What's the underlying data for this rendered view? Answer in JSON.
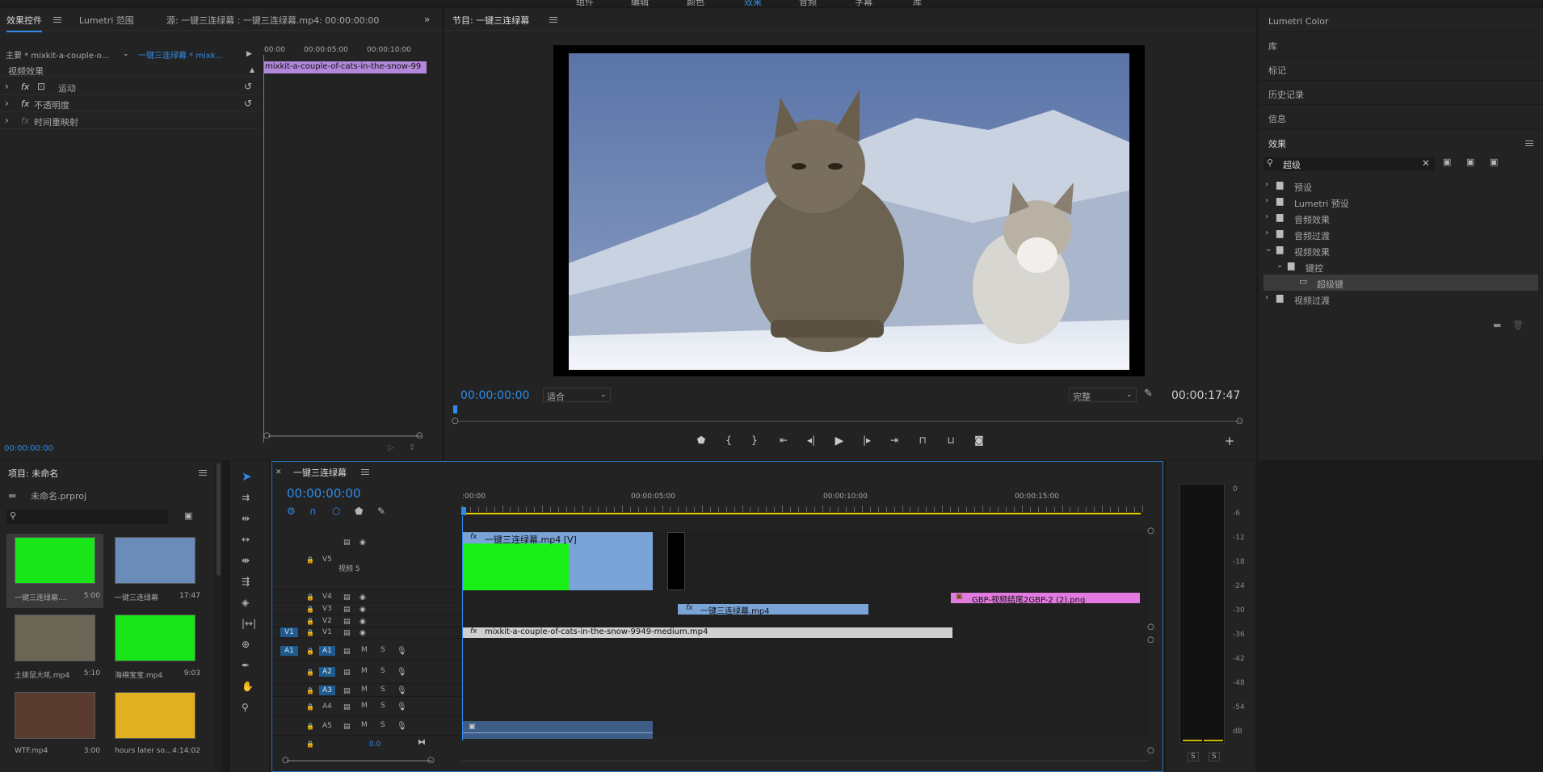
{
  "topbar": {
    "items": [
      "组件",
      "编辑",
      "颜色",
      "效果",
      "音频",
      "字幕",
      "库"
    ],
    "active": "效果"
  },
  "effect_controls": {
    "tabs": [
      "效果控件",
      "Lumetri 范围",
      "源: 一键三连绿幕 : 一键三连绿幕.mp4: 00:00:00:00"
    ],
    "master_label": "主要 * mixkit-a-couple-o...",
    "sequence_label": "一键三连绿幕 * mixk...",
    "ruler": [
      "00:00",
      "00:00:05:00",
      "00:00:10:00"
    ],
    "clip_name": "mixkit-a-couple-of-cats-in-the-snow-99",
    "section": "视频效果",
    "effects": [
      {
        "fx": "fx",
        "label": "运动"
      },
      {
        "fx": "fx",
        "label": "不透明度"
      },
      {
        "fx": "fx",
        "label": "时间重映射"
      }
    ],
    "timecode": "00:00:00:00"
  },
  "program": {
    "title": "节目: 一键三连绿幕",
    "timecode_left": "00:00:00:00",
    "fit": "适合",
    "quality": "完整",
    "timecode_right": "00:00:17:47"
  },
  "right_panels": {
    "items": [
      "Lumetri Color",
      "库",
      "标记",
      "历史记录",
      "信息"
    ],
    "effects_title": "效果",
    "search_value": "超级",
    "tree": [
      {
        "label": "预设",
        "level": 0,
        "exp": "›"
      },
      {
        "label": "Lumetri 预设",
        "level": 0,
        "exp": "›"
      },
      {
        "label": "音频效果",
        "level": 0,
        "exp": "›"
      },
      {
        "label": "音频过渡",
        "level": 0,
        "exp": "›"
      },
      {
        "label": "视频效果",
        "level": 0,
        "exp": "⌄"
      },
      {
        "label": "键控",
        "level": 1,
        "exp": "⌄"
      },
      {
        "label": "超级键",
        "level": 2,
        "exp": ""
      },
      {
        "label": "视频过渡",
        "level": 0,
        "exp": "›"
      }
    ]
  },
  "project": {
    "title": "项目: 未命名",
    "file": "未命名.prproj",
    "items": [
      {
        "name": "一键三连绿幕....",
        "dur": "5:00",
        "color": "#19e619"
      },
      {
        "name": "一键三连绿幕",
        "dur": "17:47",
        "color": "#6b8bb8"
      },
      {
        "name": "土拨鼠大吼.mp4",
        "dur": "5:10",
        "color": "#6c6656"
      },
      {
        "name": "海绵宝宝.mp4",
        "dur": "9:03",
        "color": "#19e619"
      },
      {
        "name": "WTF.mp4",
        "dur": "3:00",
        "color": "#5a3b30"
      },
      {
        "name": "hours later so...",
        "dur": "4:14:02",
        "color": "#e0b020"
      }
    ]
  },
  "timeline": {
    "tab": "一键三连绿幕",
    "timecode": "00:00:00:00",
    "ruler": [
      ":00:00",
      "00:00:05:00",
      "00:00:10:00",
      "00:00:15:00"
    ],
    "tracks_video": [
      {
        "name": "V5",
        "sub": "视频 5"
      },
      {
        "name": "V4"
      },
      {
        "name": "V3"
      },
      {
        "name": "V2"
      },
      {
        "name": "V1",
        "src": "V1"
      }
    ],
    "tracks_audio": [
      {
        "name": "A1",
        "src": "A1"
      },
      {
        "name": "A2"
      },
      {
        "name": "A3"
      },
      {
        "name": "A4"
      },
      {
        "name": "A5"
      }
    ],
    "mute": "M",
    "solo": "S",
    "master_vol": "0.0",
    "clips": {
      "v5": "一键三连绿幕.mp4 [V]",
      "v4": "GBP-视频结尾2GBP-2 (2).png",
      "v3": "一键三连绿幕.mp4",
      "v1": "mixkit-a-couple-of-cats-in-the-snow-9949-medium.mp4"
    }
  },
  "meter": {
    "scale": [
      "0",
      "-6",
      "-12",
      "-18",
      "-24",
      "-30",
      "-36",
      "-42",
      "-48",
      "-54",
      "dB"
    ],
    "solo": [
      "S",
      "S"
    ]
  }
}
